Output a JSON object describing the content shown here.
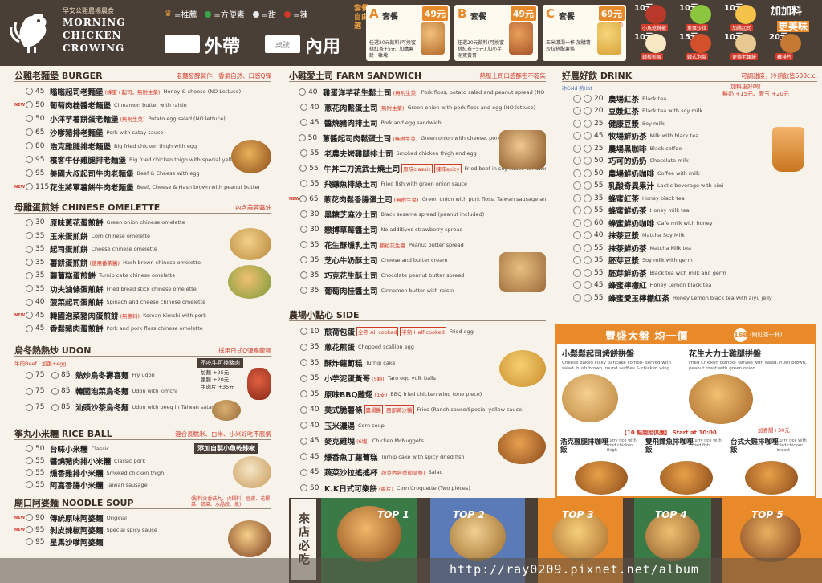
{
  "header": {
    "brand_zh": "早安公雞農場晨食",
    "brand_en_1": "MORNING",
    "brand_en_2": "CHICKEN",
    "brand_en_3": "CROWING",
    "legend": [
      {
        "icon": "crown-icon",
        "label": "=推薦",
        "color": "#f0a040"
      },
      {
        "icon": "green-dot",
        "label": "=方便素",
        "color": "#3aa54a"
      },
      {
        "icon": "blue-dot",
        "label": "=甜",
        "color": "#e9e9e9"
      },
      {
        "icon": "red-dot",
        "label": "=辣",
        "color": "#d23a2a"
      }
    ],
    "takeout_label": "外帶",
    "table_label": "桌號",
    "dinein_label": "內用",
    "sets_title": "套餐自由選",
    "sets": [
      {
        "letter": "A",
        "label": "套餐",
        "price": "49元",
        "desc": "任選20元飲料(可換蜜桃紅茶+5元) 加購薯餅+雞塊"
      },
      {
        "letter": "B",
        "label": "套餐",
        "price": "49元",
        "desc": "任選20元飲料(可換蜜桃紅茶+5元) 加小芋泥蛋黃哥"
      },
      {
        "letter": "C",
        "label": "套餐",
        "price": "69元",
        "sub": "(秋冬限定)",
        "desc": "玉米濃湯一杯 加購薯沙拉搭配薯條"
      }
    ],
    "addon_title": "加加料",
    "addon_sub": "更美味",
    "addons": [
      {
        "price": "10元",
        "label": "小魚乾辣椒"
      },
      {
        "price": "10元",
        "label": "蔥蛋沙拉"
      },
      {
        "price": "10元",
        "label": "加購起司"
      },
      {
        "price": "10元",
        "label": "鐵板煎蛋"
      },
      {
        "price": "15元",
        "label": "韓式泡菜"
      },
      {
        "price": "10元",
        "label": "更換老麵饅"
      },
      {
        "price": "20元",
        "label": "雞排片"
      }
    ]
  },
  "burger": {
    "title": "公雞老麵堡 BURGER",
    "note": "老麵發酵製作，香氣自然、口感Q彈",
    "items": [
      {
        "mark": "",
        "price": "45",
        "name": "嗡嗡起司老麵堡",
        "tag": "(蜂蜜+起司，無附生菜)",
        "en": "Honey & cheese (NO Lettuce)"
      },
      {
        "mark": "NEW",
        "price": "50",
        "name": "葡萄肉桂醬老麵堡",
        "tag": "",
        "en": "Cinnamon butter with raisin"
      },
      {
        "mark": "",
        "price": "50",
        "name": "小洋芋薯餅蛋老麵堡",
        "tag": "(無附生菜)",
        "en": "Potato egg salad (NO lettuce)"
      },
      {
        "mark": "",
        "price": "65",
        "name": "沙嗲豬排老麵堡",
        "tag": "",
        "en": "Pork with satay sauce"
      },
      {
        "mark": "",
        "price": "80",
        "name": "浩克雞腿排老麵堡",
        "tag": "",
        "en": "Big fried chicken thigh with egg"
      },
      {
        "mark": "",
        "price": "95",
        "name": "檳客牛仔雞腿排老麵堡",
        "tag": "",
        "en": "Big fried chicken thigh with special yellow sauce"
      },
      {
        "mark": "",
        "price": "95",
        "name": "美國大叔起司牛肉老麵堡",
        "tag": "",
        "en": "Beef & Cheese with egg"
      },
      {
        "mark": "NEW",
        "price": "115",
        "name": "花生將軍薯餅牛肉老麵堡",
        "tag": "",
        "en": "Beef, Cheese & Hash brown with peanut butter"
      }
    ]
  },
  "omelette": {
    "title": "母雞蛋煎餅 CHINESE OMELETTE",
    "note": "內含蒜蓉醬油",
    "items": [
      {
        "mark": "",
        "price": "30",
        "name": "原味蔥花蛋煎餅",
        "tag": "",
        "en": "Green onion chinese omelette"
      },
      {
        "mark": "",
        "price": "35",
        "name": "玉米蛋煎餅",
        "tag": "",
        "en": "Corn chinese omelette"
      },
      {
        "mark": "",
        "price": "35",
        "name": "起司蛋煎餅",
        "tag": "",
        "en": "Cheese chinese omelette"
      },
      {
        "mark": "",
        "price": "35",
        "name": "薯餅蛋煎餅",
        "tag": "(使用番茶醬)",
        "en": "Hash brown chinese omelette"
      },
      {
        "mark": "",
        "price": "35",
        "name": "蘿蔔糕蛋煎餅",
        "tag": "",
        "en": "Turnip cake chinese omelette"
      },
      {
        "mark": "",
        "price": "35",
        "name": "功夫油條蛋煎餅",
        "tag": "",
        "en": "Fried bread stick chinese omelette"
      },
      {
        "mark": "",
        "price": "40",
        "name": "菠菜起司蛋煎餅",
        "tag": "",
        "en": "Spinach and cheese chinese omelette"
      },
      {
        "mark": "NEW",
        "price": "45",
        "name": "韓國泡菜豬肉蛋煎餅",
        "tag": "(無蔥料)",
        "en": "Korean Kimchi with pork"
      },
      {
        "mark": "",
        "price": "45",
        "name": "香鬆豬肉蛋煎餅",
        "tag": "",
        "en": "Pork and pork floss chinese omelette"
      }
    ]
  },
  "udon": {
    "title": "烏冬熱熱炒 UDON",
    "note": "採用日式Q彈烏龍麵",
    "beef_label": "牛肉Beef",
    "egg_label": "加蛋+egg",
    "not_beef": "不吃牛可換豬肉",
    "extras": [
      "加麵 +25元",
      "番腸 +20元",
      "牛肉片 +35元"
    ],
    "items": [
      {
        "price": "75",
        "price2": "85",
        "name": "熱炒烏冬壽喜麵",
        "tag": "",
        "en": "Fry udon"
      },
      {
        "price": "75",
        "price2": "85",
        "name": "韓國泡菜烏冬麵",
        "tag": "",
        "en": "Udon with kimchi"
      },
      {
        "price": "75",
        "price2": "85",
        "name": "汕頭沙茶烏冬麵",
        "tag": "",
        "en": "Udon with beeg in Taiwan satay"
      }
    ]
  },
  "riceball": {
    "title": "筝丸小米糰 RICE BALL",
    "note": "混合長糯米、白米、小米好吃不脹氣",
    "banner": "添加自製小魚乾辣椒",
    "items": [
      {
        "mark": "",
        "price": "50",
        "name": "台味小米糰",
        "tag": "",
        "en": "Classic"
      },
      {
        "mark": "",
        "price": "55",
        "name": "醬燒豬肉排小米糰",
        "tag": "",
        "en": "Classic pork"
      },
      {
        "mark": "",
        "price": "55",
        "name": "燻香雞排小米糰",
        "tag": "",
        "en": "Smoked chicken thigh"
      },
      {
        "mark": "",
        "price": "55",
        "name": "阿嘉香腸小米糰",
        "tag": "",
        "en": "Taiwan sausage"
      }
    ]
  },
  "noodle": {
    "title": "廟口阿婆麵 NOODLE SOUP",
    "note": "(配料含香菇丸、火鍋料、豆皮、花椰菜、蔬菜、水晶餃、魚)",
    "items": [
      {
        "mark": "NEW",
        "price": "90",
        "name": "傳統原味阿婆麵",
        "tag": "",
        "en": "Original"
      },
      {
        "mark": "NEW",
        "price": "95",
        "name": "剝皮辣椒阿婆麵",
        "tag": "",
        "en": "Special spicy sauce"
      },
      {
        "mark": "",
        "price": "95",
        "name": "星馬沙嗲阿婆麵",
        "tag": "",
        "en": ""
      }
    ]
  },
  "toast": {
    "title": "小雞愛土司 FARM SANDWICH",
    "note": "熱壓土司口感酥密不乾柴",
    "items": [
      {
        "mark": "",
        "price": "40",
        "name": "雞蛋洋芋花生鬆土司",
        "tag": "(無附生菜)",
        "en": "Pork floss, potato salad and peanut spread (NO lettuce)"
      },
      {
        "mark": "",
        "price": "40",
        "name": "蔥花肉鬆蛋土司",
        "tag": "(無附生菜)",
        "en": "Green onion with pork floss and egg (NO lettuce)"
      },
      {
        "mark": "",
        "price": "45",
        "name": "醬燒豬肉排土司",
        "tag": "",
        "en": "Pork and egg sandwich"
      },
      {
        "mark": "",
        "price": "50",
        "name": "蔥醬起司肉鬆蛋土司",
        "tag": "(無附生菜)",
        "en": "Green onion with cheese, pork floss and egg (NO lettuce)"
      },
      {
        "mark": "",
        "price": "55",
        "name": "老農夫烤雞腿排土司",
        "tag": "",
        "en": "Smoked chicken thigh and egg"
      },
      {
        "mark": "",
        "price": "55",
        "name": "牛丼二刀流武士燒土司",
        "tag": "",
        "en": "Fried beef in soy sauce sandwich",
        "tag2": "原味classic",
        "tag3": "辣味spicy"
      },
      {
        "mark": "",
        "price": "55",
        "name": "飛鏢魚排綠土司",
        "tag": "",
        "en": "Fried fish with green onion sauce"
      },
      {
        "mark": "NEW",
        "price": "65",
        "name": "蔥花肉鬆香腸蛋土司",
        "tag": "(無附生菜)",
        "en": "Green onion with pork floss, Taiwan sausage and egg (NO lettuce)"
      },
      {
        "mark": "",
        "price": "30",
        "name": "黑糖芝麻沙土司",
        "tag": "",
        "en": "Black sesame spread (peanut included)"
      },
      {
        "mark": "",
        "price": "30",
        "name": "戀搏草莓醬土司",
        "tag": "",
        "en": "No additives strawberry spread"
      },
      {
        "mark": "",
        "price": "35",
        "name": "花生酥燻乳土司",
        "tag": "顆粒花生醬",
        "en": "Peanut butter spread"
      },
      {
        "mark": "",
        "price": "35",
        "name": "芝心牛奶酥土司",
        "tag": "",
        "en": "Cheese and butter cream"
      },
      {
        "mark": "",
        "price": "35",
        "name": "巧克花生酥土司",
        "tag": "",
        "en": "Chocolate peanut butter spread"
      },
      {
        "mark": "",
        "price": "35",
        "name": "葡萄肉桂醬土司",
        "tag": "",
        "en": "Cinnamon butter with raisin"
      }
    ]
  },
  "side": {
    "title": "農場小點心 SIDE",
    "items": [
      {
        "mark": "",
        "price": "10",
        "name": "煎荷包蛋",
        "tag": "",
        "en": "Fried egg",
        "tag2": "全熟 All cooked",
        "tag3": "半熟 Half cooked"
      },
      {
        "mark": "",
        "price": "35",
        "name": "蔥花煎蛋",
        "tag": "",
        "en": "Chopped scallion egg"
      },
      {
        "mark": "",
        "price": "35",
        "name": "酥炸蘿蔔糕",
        "tag": "",
        "en": "Turnip cake"
      },
      {
        "mark": "",
        "price": "35",
        "name": "小芋泥蛋黃哥",
        "tag": "(5顆)",
        "en": "Taro egg yolk balls"
      },
      {
        "mark": "",
        "price": "35",
        "name": "原味BBQ雞翅",
        "tag": "(1支)",
        "en": "BBQ fried chicken wing (one piece)"
      },
      {
        "mark": "",
        "price": "40",
        "name": "美式脆薯條",
        "tag": "",
        "en": "Fries (Ranch sauce/Special yellow sauce)",
        "tag2": "農場醬",
        "tag3": "西部黃沙醬"
      },
      {
        "mark": "",
        "price": "40",
        "name": "玉米濃湯",
        "tag": "",
        "en": "Corn soup"
      },
      {
        "mark": "",
        "price": "45",
        "name": "麥克雞塊",
        "tag": "(6塊)",
        "en": "Chicken McNuggets"
      },
      {
        "mark": "",
        "price": "45",
        "name": "爆香魚丁蘿蔔糕",
        "tag": "",
        "en": "Turnip cake with spicy dried fish"
      },
      {
        "mark": "",
        "price": "45",
        "name": "蔬菜沙拉搖搖杯",
        "tag": "(蔬菜內容季節調整)",
        "en": "Salad"
      },
      {
        "mark": "",
        "price": "50",
        "name": "K.K日式可樂餅",
        "tag": "(兩片)",
        "en": "Corn Croquette (Two pieces)"
      }
    ]
  },
  "drink": {
    "title": "好農好飲 DRINK",
    "note": "可調甜度，冷熱飲皆500c.c.",
    "cold_hot": "冰Cold 熱Hot",
    "fresh_milk": "加料更好喝！",
    "fresh_milk2": "鮮奶 +15元、愛玉 +20元",
    "items": [
      {
        "price": "20",
        "name": "農場紅茶",
        "en": "Black tea"
      },
      {
        "price": "20",
        "name": "豆漿紅茶",
        "en": "Black tea with soy milk"
      },
      {
        "price": "25",
        "name": "健康豆漿",
        "en": "Soy milk"
      },
      {
        "price": "45",
        "name": "牧場鮮奶茶",
        "en": "Milk with black tea"
      },
      {
        "price": "25",
        "name": "農場黑咖啡",
        "en": "Black coffee"
      },
      {
        "price": "50",
        "name": "巧可的奶奶",
        "en": "Chocolate milk"
      },
      {
        "price": "50",
        "name": "農場鮮奶咖啡",
        "en": "Coffee with milk"
      },
      {
        "price": "55",
        "name": "乳酸奇異果汁",
        "en": "Lactic beverage with kiwi"
      },
      {
        "price": "35",
        "name": "蜂蜜紅茶",
        "en": "Honey black tea"
      },
      {
        "price": "55",
        "name": "蜂蜜鮮奶茶",
        "en": "Honey milk tea"
      },
      {
        "price": "60",
        "name": "蜂蜜鮮奶咖啡",
        "en": "Cafe milk with honey"
      },
      {
        "price": "40",
        "name": "抹茶豆漿",
        "en": "Matcha Soy Milk"
      },
      {
        "price": "55",
        "name": "抹茶鮮奶茶",
        "en": "Matcha Milk tea"
      },
      {
        "price": "35",
        "name": "胚芽豆漿",
        "en": "Soy milk with germ"
      },
      {
        "price": "55",
        "name": "胚芽鮮奶茶",
        "en": "Black tea with milk and germ"
      },
      {
        "price": "45",
        "name": "蜂蜜檸檬紅",
        "en": "Honey Lemon black tea"
      },
      {
        "price": "55",
        "name": "蜂蜜愛玉檸檬紅茶",
        "en": "Honey Lemon black tea with aiyu jelly"
      }
    ]
  },
  "platter": {
    "title": "豐盛大盤 均一價",
    "badge": "168",
    "badge_note": "(附紅茶一杯)",
    "item1": {
      "name": "小鬆鬆起司烤餅拼盤",
      "en": "Cheese baked Flaky pancake combo- served with salad, hush brown, round waffles & chicken wing"
    },
    "item2": {
      "name": "花生大力士雞腿拼盤",
      "en": "Fried Chicken combo- served with salad, hush brown, peanut toast with green onion"
    },
    "start": "【10 點開始供應】 Start at 10:00",
    "add_egg": "加香腸+30元",
    "rice": [
      {
        "name": "浩克雞腿排咖哩飯",
        "en": "Curry rice with fried chicken thigh"
      },
      {
        "name": "雙飛鐔魚排咖哩飯",
        "en": "Curry rice with fried fish"
      },
      {
        "name": "台式大雞排咖哩飯",
        "en": "Curry rice with fried chicken breast"
      }
    ]
  },
  "bottom": {
    "visit_label": "來店必吃",
    "tops": [
      "TOP 1",
      "TOP 2",
      "TOP 3",
      "TOP 4",
      "TOP 5"
    ],
    "watermark": "http://ray0209.pixnet.net/album"
  }
}
